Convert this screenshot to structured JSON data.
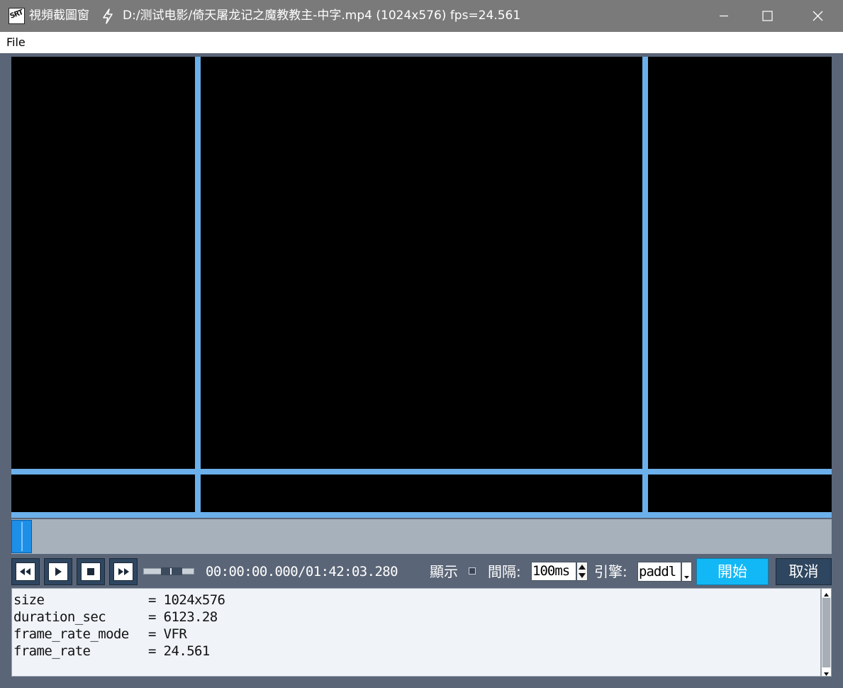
{
  "window": {
    "app_icon_label": "SRT",
    "app_name": "視頻截圖窗",
    "title": "D:/测试电影/倚天屠龙记之魔教教主-中字.mp4   (1024x576)   fps=24.561",
    "icons": [
      "app-icon",
      "lightning-icon",
      "minimize-icon",
      "maximize-icon",
      "close-icon"
    ]
  },
  "menu": {
    "file": "File"
  },
  "player": {
    "time": "00:00:00.000/01:42:03.280",
    "seek_progress": 0.0,
    "volume_level": 0.6,
    "show_label": "顯示",
    "show_checked": false,
    "interval_label": "間隔:",
    "interval_value": "100ms",
    "engine_label": "引擎:",
    "engine_value": "paddl",
    "start_label": "開始",
    "cancel_label": "取消",
    "controls": [
      "rewind-icon",
      "play-icon",
      "stop-icon",
      "fast-forward-icon"
    ]
  },
  "info": {
    "lines": [
      {
        "key": "size",
        "value": "= 1024x576"
      },
      {
        "key": "duration_sec",
        "value": "= 6123.28"
      },
      {
        "key": "frame_rate_mode",
        "value": "= VFR"
      },
      {
        "key": "frame_rate",
        "value": "= 24.561"
      }
    ]
  },
  "colors": {
    "background": "#5a6577",
    "grid_line": "#6bb0ea",
    "accent": "#12b8f6",
    "button_dark": "#2f4660"
  }
}
